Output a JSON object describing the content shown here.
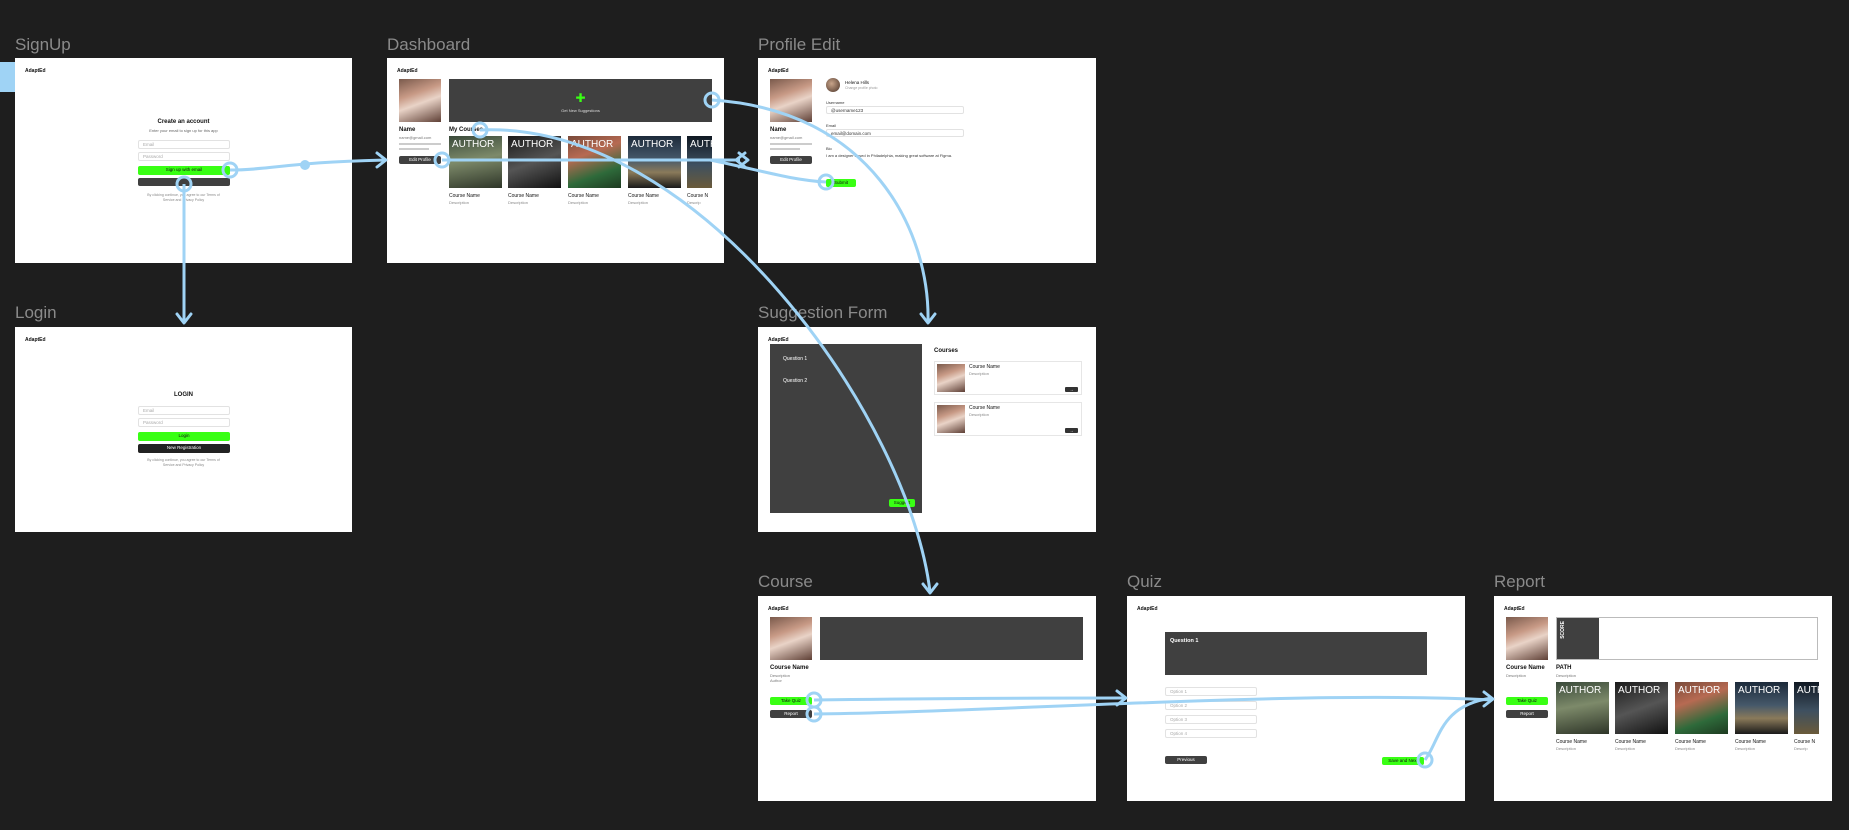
{
  "brand": "AdaptEd",
  "frames": {
    "signup": {
      "label": "SignUp",
      "title": "Create an account",
      "subtitle": "Enter your email to sign up for this app",
      "email_placeholder": "Email",
      "password_placeholder": "Password",
      "primary_button": "Sign up with email",
      "terms_line1": "By clicking continue, you agree to our Terms of",
      "terms_line2": "Service and Privacy Policy"
    },
    "login": {
      "label": "Login",
      "title": "LOGIN",
      "email_placeholder": "Email",
      "password_placeholder": "Password",
      "login_button": "Login",
      "register_button": "New Registration",
      "terms_line1": "By clicking continue, you agree to our Terms of",
      "terms_line2": "Service and Privacy Policy"
    },
    "dashboard": {
      "label": "Dashboard",
      "profile_name": "Name",
      "profile_email": "name@gmail.com",
      "edit_profile_button": "Edit Profile",
      "suggestions_label": "Get New Suggestions",
      "section_title": "My Courses",
      "courses": [
        {
          "author": "AUTHOR",
          "name": "Course Name",
          "desc": "Description"
        },
        {
          "author": "AUTHOR",
          "name": "Course Name",
          "desc": "Description"
        },
        {
          "author": "AUTHOR",
          "name": "Course Name",
          "desc": "Description"
        },
        {
          "author": "AUTHOR",
          "name": "Course Name",
          "desc": "Description"
        },
        {
          "author": "AUTH",
          "name": "Course N",
          "desc": "Descrip"
        }
      ]
    },
    "profile_edit": {
      "label": "Profile Edit",
      "profile_name": "Name",
      "profile_email": "name@gmail.com",
      "edit_profile_button": "Edit Profile",
      "user_name": "Helena Hills",
      "user_sub": "Change profile photo",
      "username_label": "Username",
      "username_value": "@username123",
      "email_label": "Email",
      "email_value": "email@domain.com",
      "bio_label": "Bio",
      "bio_value": "I am a designer based in Philadelphia, making great software at Figma.",
      "submit_button": "Submit"
    },
    "suggestion_form": {
      "label": "Suggestion Form",
      "question1": "Question 1",
      "question2": "Question 2",
      "suggest_button": "Suggest",
      "courses_title": "Courses",
      "courses": [
        {
          "name": "Course Name",
          "desc": "Description"
        },
        {
          "name": "Course Name",
          "desc": "Description"
        }
      ]
    },
    "course": {
      "label": "Course",
      "course_name": "Course Name",
      "desc": "Description",
      "author": "Author",
      "take_quiz_button": "Take Quiz",
      "report_button": "Report"
    },
    "quiz": {
      "label": "Quiz",
      "question": "Question 1",
      "options": [
        "Option 1",
        "Option 2",
        "Option 3",
        "Option 4"
      ],
      "previous_button": "Previous",
      "next_button": "Save and Next"
    },
    "report": {
      "label": "Report",
      "course_name": "Course Name",
      "desc": "Description",
      "score_label": "SCORE",
      "path_label": "PATH",
      "path_desc": "Description",
      "take_quiz_button": "Take Quiz",
      "report_button": "Report",
      "courses": [
        {
          "author": "AUTHOR",
          "name": "Course Name",
          "desc": "Description"
        },
        {
          "author": "AUTHOR",
          "name": "Course Name",
          "desc": "Description"
        },
        {
          "author": "AUTHOR",
          "name": "Course Name",
          "desc": "Description"
        },
        {
          "author": "AUTHOR",
          "name": "Course Name",
          "desc": "Description"
        },
        {
          "author": "AUTH",
          "name": "Course N",
          "desc": "Descrip"
        }
      ]
    }
  },
  "colors": {
    "canvas": "#1e1e1e",
    "accent": "#39ff14",
    "connector": "#9fd3f5",
    "panel": "#404040"
  }
}
